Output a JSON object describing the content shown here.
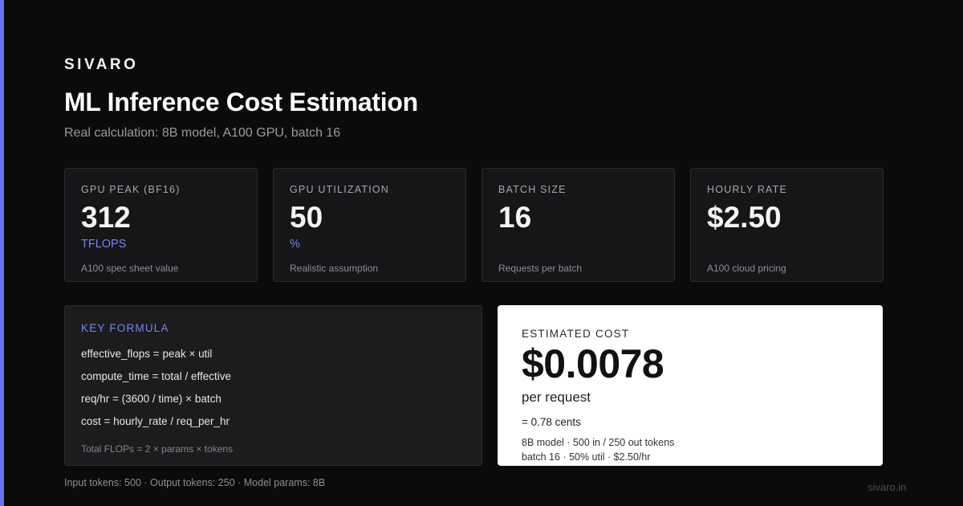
{
  "brand": "SIVARO",
  "title": "ML Inference Cost Estimation",
  "subtitle": "Real calculation: 8B model, A100 GPU, batch 16",
  "accent_color": "#6b74e6",
  "cards": [
    {
      "label": "GPU PEAK (BF16)",
      "value": "312",
      "unit": "TFLOPS",
      "note": "A100 spec sheet value"
    },
    {
      "label": "GPU UTILIZATION",
      "value": "50",
      "unit": "%",
      "note": "Realistic assumption"
    },
    {
      "label": "BATCH SIZE",
      "value": "16",
      "unit": "",
      "note": "Requests per batch"
    },
    {
      "label": "HOURLY RATE",
      "value": "$2.50",
      "unit": "",
      "note": "A100 cloud pricing"
    }
  ],
  "formula": {
    "heading": "KEY FORMULA",
    "lines": [
      "effective_flops = peak × util",
      "compute_time = total / effective",
      "req/hr = (3600 / time) × batch",
      "cost = hourly_rate / req_per_hr"
    ],
    "note": "Total FLOPs = 2 × params × tokens"
  },
  "cost": {
    "label": "ESTIMATED COST",
    "value": "$0.0078",
    "per": "per request",
    "cents": "= 0.78 cents",
    "details": [
      "8B model · 500 in / 250 out tokens",
      "batch 16 · 50% util · $2.50/hr"
    ]
  },
  "footer": {
    "inputs": "Input tokens: 500 · Output tokens: 250 · Model params: 8B",
    "site": "sivaro.in"
  }
}
